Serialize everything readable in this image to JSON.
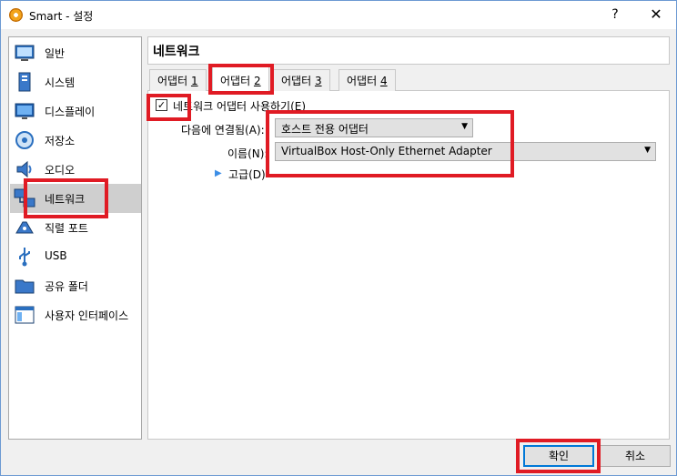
{
  "window": {
    "title": "Smart - 설정",
    "help_glyph": "?",
    "close_glyph": "✕"
  },
  "sidebar": {
    "items": [
      {
        "label": "일반",
        "icon": "general-icon"
      },
      {
        "label": "시스템",
        "icon": "system-icon"
      },
      {
        "label": "디스플레이",
        "icon": "display-icon"
      },
      {
        "label": "저장소",
        "icon": "storage-icon"
      },
      {
        "label": "오디오",
        "icon": "audio-icon"
      },
      {
        "label": "네트워크",
        "icon": "network-icon",
        "selected": true
      },
      {
        "label": "직렬 포트",
        "icon": "serial-port-icon"
      },
      {
        "label": "USB",
        "icon": "usb-icon"
      },
      {
        "label": "공유 폴더",
        "icon": "shared-folder-icon"
      },
      {
        "label": "사용자 인터페이스",
        "icon": "user-interface-icon"
      }
    ]
  },
  "panel": {
    "title": "네트워크"
  },
  "tabs": [
    {
      "label": "어댑터 ",
      "num": "1"
    },
    {
      "label": "어댑터 ",
      "num": "2",
      "active": true
    },
    {
      "label": "어댑터 ",
      "num": "3"
    },
    {
      "label": "어댑터 ",
      "num": "4"
    }
  ],
  "form": {
    "enable_checkbox_label": "네트워크 어댑터 사용하기(E)",
    "enable_checked": true,
    "attached_label": "다음에 연결됨(A):",
    "attached_value": "호스트 전용 어댑터",
    "name_label": "이름(N):",
    "name_value": "VirtualBox Host-Only Ethernet Adapter",
    "advanced_label": "고급(D)"
  },
  "buttons": {
    "ok": "확인",
    "cancel": "취소"
  },
  "colors": {
    "highlight": "#e01b24",
    "selection": "#cfcfcf",
    "accent": "#0078d7"
  }
}
